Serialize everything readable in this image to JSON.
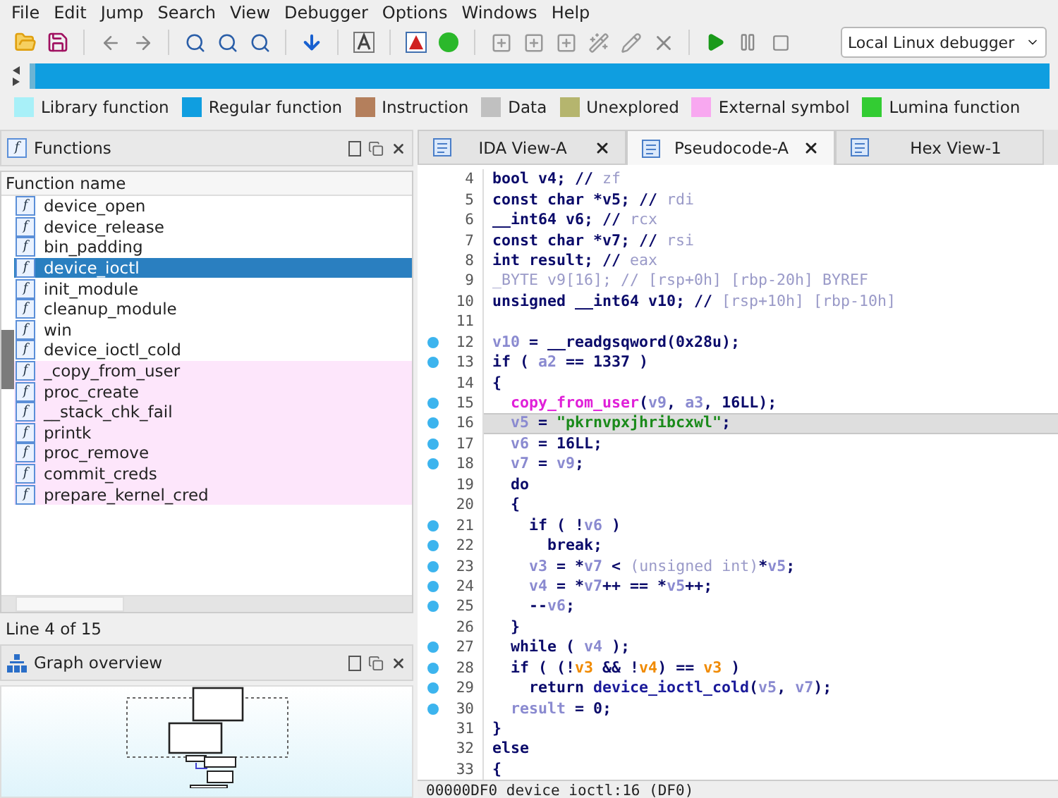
{
  "menu": [
    "File",
    "Edit",
    "Jump",
    "Search",
    "View",
    "Debugger",
    "Options",
    "Windows",
    "Help"
  ],
  "toolbar": {
    "debugger_select": "Local Linux debugger"
  },
  "legend": [
    {
      "label": "Library function",
      "color": "#a8f0f8"
    },
    {
      "label": "Regular function",
      "color": "#0f9ee0"
    },
    {
      "label": "Instruction",
      "color": "#b47f5c"
    },
    {
      "label": "Data",
      "color": "#c0c0c0"
    },
    {
      "label": "Unexplored",
      "color": "#b5b56e"
    },
    {
      "label": "External symbol",
      "color": "#f8a8f0"
    },
    {
      "label": "Lumina function",
      "color": "#33cc33"
    }
  ],
  "functions_pane": {
    "icon": "f",
    "title": "Functions",
    "column": "Function name",
    "status": "Line 4 of 15",
    "rows": [
      {
        "icon": "f",
        "name": "device_open",
        "kind": "regular",
        "selected": false
      },
      {
        "icon": "f",
        "name": "device_release",
        "kind": "regular",
        "selected": false
      },
      {
        "icon": "f",
        "name": "bin_padding",
        "kind": "regular",
        "selected": false
      },
      {
        "icon": "f",
        "name": "device_ioctl",
        "kind": "regular",
        "selected": true
      },
      {
        "icon": "f",
        "name": "init_module",
        "kind": "regular",
        "selected": false
      },
      {
        "icon": "f",
        "name": "cleanup_module",
        "kind": "regular",
        "selected": false
      },
      {
        "icon": "f",
        "name": "win",
        "kind": "regular",
        "selected": false
      },
      {
        "icon": "f",
        "name": "device_ioctl_cold",
        "kind": "regular",
        "selected": false
      },
      {
        "icon": "f",
        "name": "_copy_from_user",
        "kind": "external",
        "selected": false
      },
      {
        "icon": "f",
        "name": "proc_create",
        "kind": "external",
        "selected": false
      },
      {
        "icon": "f",
        "name": "__stack_chk_fail",
        "kind": "external",
        "selected": false
      },
      {
        "icon": "f",
        "name": "printk",
        "kind": "external",
        "selected": false
      },
      {
        "icon": "f",
        "name": "proc_remove",
        "kind": "external",
        "selected": false
      },
      {
        "icon": "f",
        "name": "commit_creds",
        "kind": "external",
        "selected": false
      },
      {
        "icon": "f",
        "name": "prepare_kernel_cred",
        "kind": "external",
        "selected": false
      }
    ]
  },
  "graph_pane": {
    "title": "Graph overview"
  },
  "tabs": [
    {
      "label": "IDA View-A",
      "selected": false,
      "closable": true
    },
    {
      "label": "Pseudocode-A",
      "selected": true,
      "closable": true
    },
    {
      "label": "Hex View-1",
      "selected": false,
      "closable": false
    }
  ],
  "code": {
    "status": "00000DF0 device_ioctl:16 (DF0)",
    "lines": [
      {
        "number": "4",
        "breakpoint": false,
        "current": false,
        "segments": [
          {
            "kind": "k",
            "text": "bool v4; // "
          },
          {
            "kind": "c",
            "text": "zf"
          }
        ]
      },
      {
        "number": "5",
        "breakpoint": false,
        "current": false,
        "segments": [
          {
            "kind": "k",
            "text": "const char *v5; // "
          },
          {
            "kind": "c",
            "text": "rdi"
          }
        ]
      },
      {
        "number": "6",
        "breakpoint": false,
        "current": false,
        "segments": [
          {
            "kind": "k",
            "text": "__int64 v6; // "
          },
          {
            "kind": "c",
            "text": "rcx"
          }
        ]
      },
      {
        "number": "7",
        "breakpoint": false,
        "current": false,
        "segments": [
          {
            "kind": "k",
            "text": "const char *v7; // "
          },
          {
            "kind": "c",
            "text": "rsi"
          }
        ]
      },
      {
        "number": "8",
        "breakpoint": false,
        "current": false,
        "segments": [
          {
            "kind": "k",
            "text": "int result; // "
          },
          {
            "kind": "c",
            "text": "eax"
          }
        ]
      },
      {
        "number": "9",
        "breakpoint": false,
        "current": false,
        "segments": [
          {
            "kind": "c",
            "text": "_BYTE v9[16]; // [rsp+0h] [rbp-20h] BYREF"
          }
        ]
      },
      {
        "number": "10",
        "breakpoint": false,
        "current": false,
        "segments": [
          {
            "kind": "k",
            "text": "unsigned __int64 v10; // "
          },
          {
            "kind": "c",
            "text": "[rsp+10h] [rbp-10h]"
          }
        ]
      },
      {
        "number": "11",
        "breakpoint": false,
        "current": false
      },
      {
        "number": "12",
        "breakpoint": true,
        "current": false,
        "segments": [
          {
            "kind": "v",
            "text": "v10"
          },
          {
            "kind": "k",
            "text": " = __readgsqword(0x28u);"
          }
        ]
      },
      {
        "number": "13",
        "breakpoint": true,
        "current": false,
        "segments": [
          {
            "kind": "k",
            "text": "if ( "
          },
          {
            "kind": "v",
            "text": "a2"
          },
          {
            "kind": "k",
            "text": " == 1337 )"
          }
        ]
      },
      {
        "number": "14",
        "breakpoint": false,
        "current": false,
        "segments": [
          {
            "kind": "k",
            "text": "{"
          }
        ]
      },
      {
        "number": "15",
        "breakpoint": true,
        "current": false,
        "segments": [
          {
            "kind": "f",
            "text": "  copy_from_user"
          },
          {
            "kind": "k",
            "text": "("
          },
          {
            "kind": "v",
            "text": "v9"
          },
          {
            "kind": "k",
            "text": ", "
          },
          {
            "kind": "v",
            "text": "a3"
          },
          {
            "kind": "k",
            "text": ", 16LL);"
          }
        ]
      },
      {
        "number": "16",
        "breakpoint": true,
        "current": true,
        "segments": [
          {
            "kind": "v",
            "text": "  v5"
          },
          {
            "kind": "k",
            "text": " = "
          },
          {
            "kind": "s",
            "text": "\"pkrnvpxjhribcxwl\""
          },
          {
            "kind": "k",
            "text": ";"
          }
        ]
      },
      {
        "number": "17",
        "breakpoint": true,
        "current": false,
        "segments": [
          {
            "kind": "v",
            "text": "  v6"
          },
          {
            "kind": "k",
            "text": " = 16LL;"
          }
        ]
      },
      {
        "number": "18",
        "breakpoint": true,
        "current": false,
        "segments": [
          {
            "kind": "v",
            "text": "  v7"
          },
          {
            "kind": "k",
            "text": " = "
          },
          {
            "kind": "v",
            "text": "v9"
          },
          {
            "kind": "k",
            "text": ";"
          }
        ]
      },
      {
        "number": "19",
        "breakpoint": false,
        "current": false,
        "segments": [
          {
            "kind": "k",
            "text": "  do"
          }
        ]
      },
      {
        "number": "20",
        "breakpoint": false,
        "current": false,
        "segments": [
          {
            "kind": "k",
            "text": "  {"
          }
        ]
      },
      {
        "number": "21",
        "breakpoint": true,
        "current": false,
        "segments": [
          {
            "kind": "k",
            "text": "    if ( !"
          },
          {
            "kind": "v",
            "text": "v6"
          },
          {
            "kind": "k",
            "text": " )"
          }
        ]
      },
      {
        "number": "22",
        "breakpoint": true,
        "current": false,
        "segments": [
          {
            "kind": "k",
            "text": "      break;"
          }
        ]
      },
      {
        "number": "23",
        "breakpoint": true,
        "current": false,
        "segments": [
          {
            "kind": "v",
            "text": "    v3"
          },
          {
            "kind": "k",
            "text": " = *"
          },
          {
            "kind": "v",
            "text": "v7"
          },
          {
            "kind": "k",
            "text": " < "
          },
          {
            "kind": "c",
            "text": "(unsigned int)"
          },
          {
            "kind": "k",
            "text": "*"
          },
          {
            "kind": "v",
            "text": "v5"
          },
          {
            "kind": "k",
            "text": ";"
          }
        ]
      },
      {
        "number": "24",
        "breakpoint": true,
        "current": false,
        "segments": [
          {
            "kind": "v",
            "text": "    v4"
          },
          {
            "kind": "k",
            "text": " = *"
          },
          {
            "kind": "v",
            "text": "v7"
          },
          {
            "kind": "k",
            "text": "++ == *"
          },
          {
            "kind": "v",
            "text": "v5"
          },
          {
            "kind": "k",
            "text": "++;"
          }
        ]
      },
      {
        "number": "25",
        "breakpoint": true,
        "current": false,
        "segments": [
          {
            "kind": "k",
            "text": "    --"
          },
          {
            "kind": "v",
            "text": "v6"
          },
          {
            "kind": "k",
            "text": ";"
          }
        ]
      },
      {
        "number": "26",
        "breakpoint": false,
        "current": false,
        "segments": [
          {
            "kind": "k",
            "text": "  }"
          }
        ]
      },
      {
        "number": "27",
        "breakpoint": true,
        "current": false,
        "segments": [
          {
            "kind": "k",
            "text": "  while ( "
          },
          {
            "kind": "v",
            "text": "v4"
          },
          {
            "kind": "k",
            "text": " );"
          }
        ]
      },
      {
        "number": "28",
        "breakpoint": true,
        "current": false,
        "segments": [
          {
            "kind": "k",
            "text": "  if ( (!"
          },
          {
            "kind": "h",
            "text": "v3"
          },
          {
            "kind": "k",
            "text": " && !"
          },
          {
            "kind": "h",
            "text": "v4"
          },
          {
            "kind": "k",
            "text": ") == "
          },
          {
            "kind": "h",
            "text": "v3"
          },
          {
            "kind": "k",
            "text": " )"
          }
        ]
      },
      {
        "number": "29",
        "breakpoint": true,
        "current": false,
        "segments": [
          {
            "kind": "k",
            "text": "    return "
          },
          {
            "kind": "n",
            "text": "device_ioctl_cold"
          },
          {
            "kind": "k",
            "text": "("
          },
          {
            "kind": "v",
            "text": "v5"
          },
          {
            "kind": "k",
            "text": ", "
          },
          {
            "kind": "v",
            "text": "v7"
          },
          {
            "kind": "k",
            "text": ");"
          }
        ]
      },
      {
        "number": "30",
        "breakpoint": true,
        "current": false,
        "segments": [
          {
            "kind": "v",
            "text": "  result"
          },
          {
            "kind": "k",
            "text": " = 0;"
          }
        ]
      },
      {
        "number": "31",
        "breakpoint": false,
        "current": false,
        "segments": [
          {
            "kind": "k",
            "text": "}"
          }
        ]
      },
      {
        "number": "32",
        "breakpoint": false,
        "current": false,
        "segments": [
          {
            "kind": "k",
            "text": "else"
          }
        ]
      },
      {
        "number": "33",
        "breakpoint": false,
        "current": false,
        "segments": [
          {
            "kind": "k",
            "text": "{"
          }
        ]
      }
    ]
  }
}
